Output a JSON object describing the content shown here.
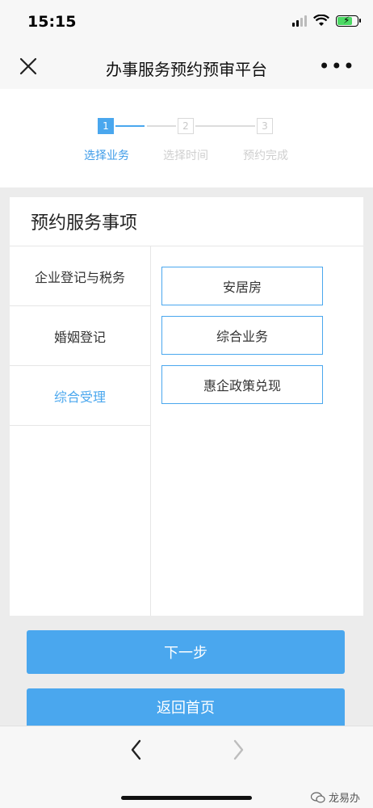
{
  "status_bar": {
    "time": "15:15"
  },
  "nav": {
    "title": "办事服务预约预审平台",
    "more": "•••"
  },
  "steps": [
    {
      "number": "1",
      "label": "选择业务",
      "active": true
    },
    {
      "number": "2",
      "label": "选择时间",
      "active": false
    },
    {
      "number": "3",
      "label": "预约完成",
      "active": false
    }
  ],
  "panel": {
    "title": "预约服务事项",
    "categories": [
      {
        "label": "企业登记与税务",
        "active": false
      },
      {
        "label": "婚姻登记",
        "active": false
      },
      {
        "label": "综合受理",
        "active": true
      }
    ],
    "options": [
      {
        "label": "安居房"
      },
      {
        "label": "综合业务"
      },
      {
        "label": "惠企政策兑现"
      }
    ]
  },
  "buttons": {
    "next": "下一步",
    "home": "返回首页"
  },
  "watermark": {
    "text": "龙易办"
  },
  "colors": {
    "accent": "#4aa7ee",
    "background": "#ececec"
  }
}
